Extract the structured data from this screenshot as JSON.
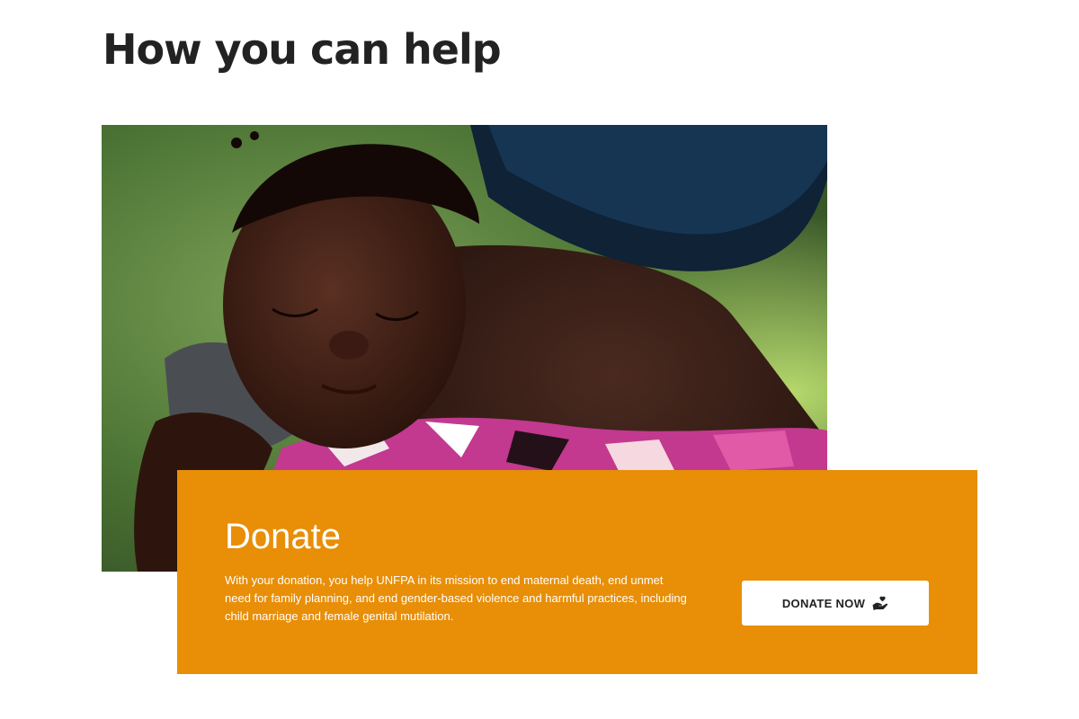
{
  "section": {
    "title": "How you can help"
  },
  "hero": {
    "image_description_icon": "photo-mother-carrying-sleeping-child"
  },
  "donate": {
    "title": "Donate",
    "description": "With your donation, you help UNFPA in its mission to end maternal death, end unmet need for family planning, and end gender-based violence and harmful practices, including child marriage and female genital mutilation.",
    "button_label": "DONATE NOW",
    "button_icon": "hand-holding-heart-icon",
    "accent_color": "#e88e07"
  }
}
